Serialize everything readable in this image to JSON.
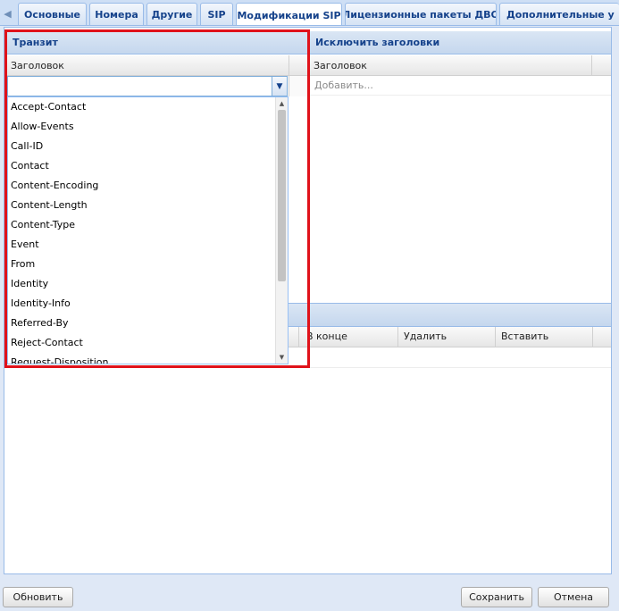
{
  "tabs": [
    {
      "label": "Основные",
      "active": false
    },
    {
      "label": "Номера",
      "active": false
    },
    {
      "label": "Другие",
      "active": false
    },
    {
      "label": "SIP",
      "active": false
    },
    {
      "label": "Модификации SIP",
      "active": true
    },
    {
      "label": "Лицензионные пакеты ДВО",
      "active": false
    },
    {
      "label": "Дополнительные у",
      "active": false
    }
  ],
  "transit": {
    "title": "Транзит",
    "column_header": "Заголовок",
    "combo_value": "",
    "dropdown_options": [
      "Accept-Contact",
      "Allow-Events",
      "Call-ID",
      "Contact",
      "Content-Encoding",
      "Content-Length",
      "Content-Type",
      "Event",
      "From",
      "Identity",
      "Identity-Info",
      "Referred-By",
      "Reject-Contact",
      "Request-Disposition"
    ]
  },
  "exclude_headers": {
    "title": "Исключить заголовки",
    "column_header": "Заголовок",
    "add_placeholder": "Добавить..."
  },
  "modifications": {
    "columns": [
      "В конце",
      "Удалить",
      "Вставить"
    ]
  },
  "buttons": {
    "refresh": "Обновить",
    "save": "Сохранить",
    "cancel": "Отмена"
  },
  "colors": {
    "accent": "#15428b",
    "highlight": "#e0121a",
    "panel_border": "#99bbe8"
  }
}
